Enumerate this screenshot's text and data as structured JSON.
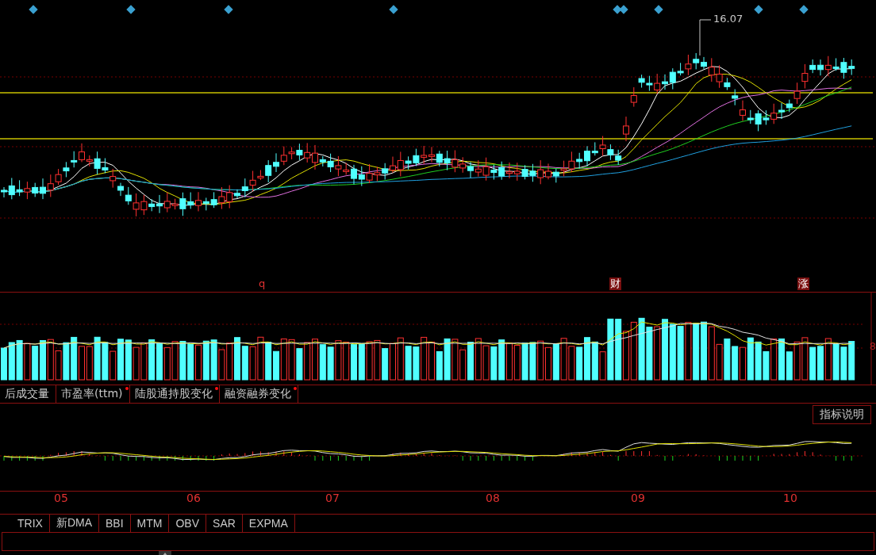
{
  "price_annotation": "16.07",
  "event_markers": [
    {
      "label": "q",
      "kind": "plain"
    },
    {
      "label": "财",
      "kind": "boxed"
    },
    {
      "label": "涨",
      "kind": "boxed"
    }
  ],
  "volume_axis_label": "8",
  "indicator_tabs": [
    {
      "label": "后成交量",
      "flagged": false
    },
    {
      "label": "市盈率(ttm)",
      "flagged": true
    },
    {
      "label": "陆股通持股变化",
      "flagged": true
    },
    {
      "label": "融资融券变化",
      "flagged": true
    }
  ],
  "indicator_help_button": "指标说明",
  "months": [
    "05",
    "06",
    "07",
    "08",
    "09",
    "10"
  ],
  "bottom_tabs": [
    "TRIX",
    "新DMA",
    "BBI",
    "MTM",
    "OBV",
    "SAR",
    "EXPMA"
  ]
}
